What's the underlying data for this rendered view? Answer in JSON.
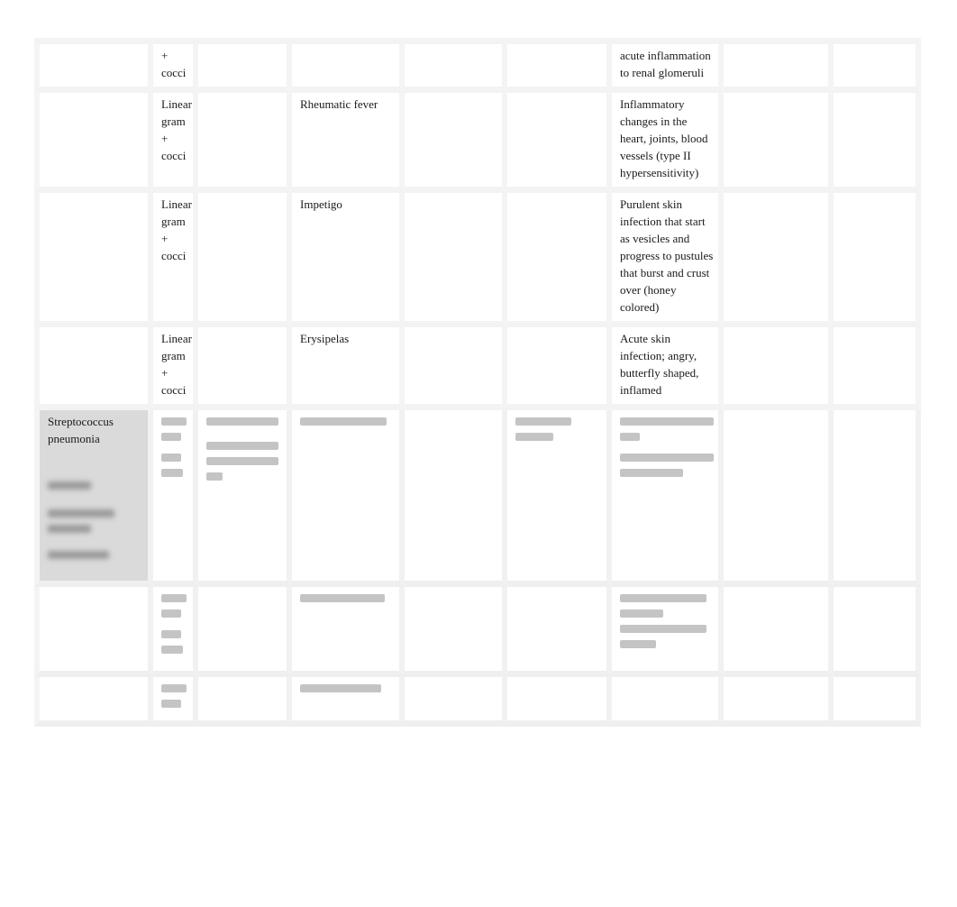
{
  "document": {
    "rows": [
      {
        "organism": "",
        "morphology": [
          "+",
          "cocci"
        ],
        "disease": "",
        "description": [
          "acute inflammation",
          "to renal glomeruli"
        ]
      },
      {
        "organism": "",
        "morphology": [
          "Linear",
          "gram",
          "+",
          "cocci"
        ],
        "disease": "Rheumatic fever",
        "description": [
          "Inflammatory",
          "changes in the",
          "heart, joints, blood",
          "vessels (type II",
          "hypersensitivity)"
        ]
      },
      {
        "organism": "",
        "morphology": [
          "Linear",
          "gram",
          "+",
          "cocci"
        ],
        "disease": "Impetigo",
        "description": [
          "Purulent skin",
          "infection that start",
          "as vesicles and",
          "progress to pustules",
          "that burst and crust",
          "over (honey",
          "colored)"
        ]
      },
      {
        "organism": "",
        "morphology": [
          "Linear",
          "gram",
          "+",
          "cocci"
        ],
        "disease": "Erysipelas",
        "description": [
          "Acute skin",
          "infection; angry,",
          "butterfly shaped,",
          "inflamed"
        ]
      },
      {
        "organism": [
          "Streptococcus",
          "pneumonia"
        ],
        "blurred": true
      }
    ],
    "blurred_notice": "content obscured"
  }
}
